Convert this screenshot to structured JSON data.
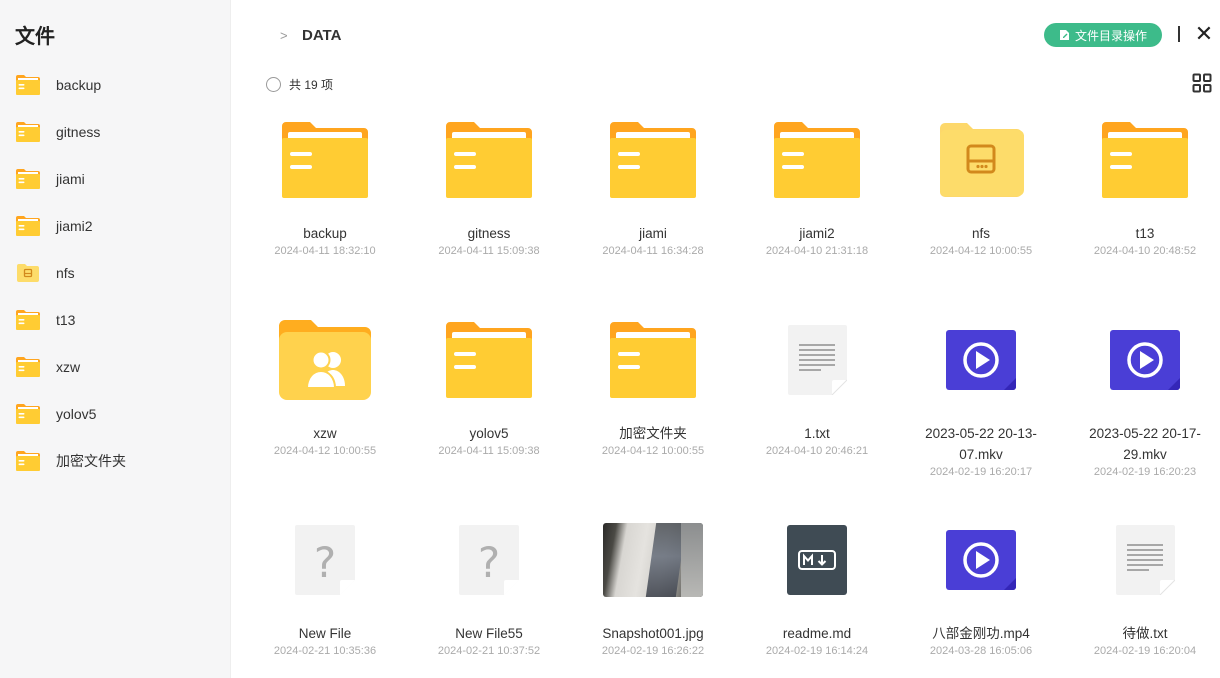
{
  "sidebar": {
    "title": "文件",
    "items": [
      {
        "label": "backup",
        "icon": "folder-icon"
      },
      {
        "label": "gitness",
        "icon": "folder-icon"
      },
      {
        "label": "jiami",
        "icon": "folder-icon"
      },
      {
        "label": "jiami2",
        "icon": "folder-icon"
      },
      {
        "label": "nfs",
        "icon": "nfs-folder-icon"
      },
      {
        "label": "t13",
        "icon": "folder-icon"
      },
      {
        "label": "xzw",
        "icon": "folder-icon"
      },
      {
        "label": "yolov5",
        "icon": "folder-icon"
      },
      {
        "label": "加密文件夹",
        "icon": "folder-icon"
      }
    ]
  },
  "header": {
    "breadcrumb_separator": ">",
    "current_folder": "DATA",
    "dir_ops_label": "文件目录操作",
    "close_label": "✕"
  },
  "toolbar": {
    "count_label": "共 19 项"
  },
  "colors": {
    "accent": "#3dbb8a",
    "folder": "#ffcc33",
    "video": "#4a3ed6",
    "markdown": "#3f4b54"
  },
  "files": [
    {
      "name": "backup",
      "date": "2024-04-11 18:32:10",
      "type": "folder"
    },
    {
      "name": "gitness",
      "date": "2024-04-11 15:09:38",
      "type": "folder"
    },
    {
      "name": "jiami",
      "date": "2024-04-11 16:34:28",
      "type": "folder"
    },
    {
      "name": "jiami2",
      "date": "2024-04-10 21:31:18",
      "type": "folder"
    },
    {
      "name": "nfs",
      "date": "2024-04-12 10:00:55",
      "type": "nfs-folder"
    },
    {
      "name": "t13",
      "date": "2024-04-10 20:48:52",
      "type": "folder"
    },
    {
      "name": "xzw",
      "date": "2024-04-12 10:00:55",
      "type": "shared-folder"
    },
    {
      "name": "yolov5",
      "date": "2024-04-11 15:09:38",
      "type": "folder"
    },
    {
      "name": "加密文件夹",
      "date": "2024-04-12 10:00:55",
      "type": "folder"
    },
    {
      "name": "1.txt",
      "date": "2024-04-10 20:46:21",
      "type": "text"
    },
    {
      "name": "2023-05-22 20-13-07.mkv",
      "date": "2024-02-19 16:20:17",
      "type": "video"
    },
    {
      "name": "2023-05-22 20-17-29.mkv",
      "date": "2024-02-19 16:20:23",
      "type": "video"
    },
    {
      "name": "New File",
      "date": "2024-02-21 10:35:36",
      "type": "unknown"
    },
    {
      "name": "New File55",
      "date": "2024-02-21 10:37:52",
      "type": "unknown"
    },
    {
      "name": "Snapshot001.jpg",
      "date": "2024-02-19 16:26:22",
      "type": "image"
    },
    {
      "name": "readme.md",
      "date": "2024-02-19 16:14:24",
      "type": "markdown"
    },
    {
      "name": "八部金刚功.mp4",
      "date": "2024-03-28 16:05:06",
      "type": "video"
    },
    {
      "name": "待做.txt",
      "date": "2024-02-19 16:20:04",
      "type": "text"
    }
  ]
}
